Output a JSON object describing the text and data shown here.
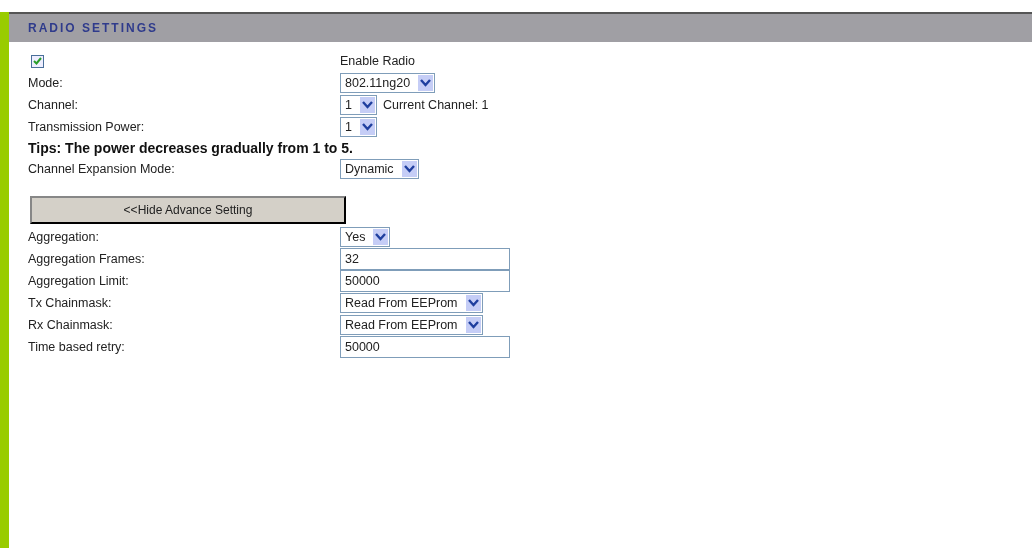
{
  "section": {
    "title": "RADIO SETTINGS"
  },
  "rows": [
    {
      "kind": "checkbox",
      "checked": true,
      "text": "Enable Radio"
    },
    {
      "kind": "select",
      "label": "Mode:",
      "value": "802.11ng20"
    },
    {
      "kind": "select",
      "label": "Channel:",
      "value": "1",
      "note": "Current Channel: 1"
    },
    {
      "kind": "select",
      "label": "Transmission Power:",
      "value": "1"
    },
    {
      "kind": "tip",
      "text": "Tips: The power decreases gradually from 1 to 5."
    },
    {
      "kind": "select",
      "label": "Channel Expansion Mode:",
      "value": "Dynamic"
    },
    {
      "kind": "button",
      "text": "<<Hide Advance Setting"
    },
    {
      "kind": "select",
      "label": "Aggregation:",
      "value": "Yes"
    },
    {
      "kind": "text",
      "label": "Aggregation Frames:",
      "value": "32"
    },
    {
      "kind": "text",
      "label": "Aggregation Limit:",
      "value": "50000"
    },
    {
      "kind": "select",
      "label": "Tx Chainmask:",
      "value": "Read From EEProm"
    },
    {
      "kind": "select",
      "label": "Rx Chainmask:",
      "value": "Read From EEProm"
    },
    {
      "kind": "text",
      "label": "Time based retry:",
      "value": "50000"
    }
  ]
}
